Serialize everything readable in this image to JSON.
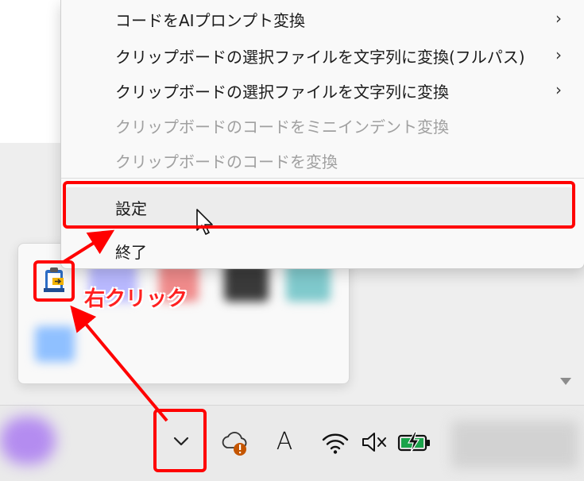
{
  "context_menu": {
    "items": [
      {
        "label": "コードをAIプロンプト変換",
        "submenu": true,
        "enabled": true
      },
      {
        "label": "クリップボードの選択ファイルを文字列に変換(フルパス)",
        "submenu": true,
        "enabled": true
      },
      {
        "label": "クリップボードの選択ファイルを文字列に変換",
        "submenu": true,
        "enabled": true
      },
      {
        "label": "クリップボードのコードをミニインデント変換",
        "submenu": false,
        "enabled": false
      },
      {
        "label": "クリップボードのコードを変換",
        "submenu": false,
        "enabled": false
      },
      {
        "label": "設定",
        "submenu": false,
        "enabled": true,
        "highlighted": true
      },
      {
        "label": "終了",
        "submenu": false,
        "enabled": true
      }
    ],
    "submenu_arrow": "›"
  },
  "annotation": {
    "label": "右クリック",
    "color": "#ff0000"
  },
  "taskbar": {
    "ime_indicator": "A",
    "icons": [
      "chevron-up-icon",
      "onedrive-warning-icon",
      "ime-icon",
      "wifi-icon",
      "volume-muted-icon",
      "battery-charging-icon"
    ]
  }
}
